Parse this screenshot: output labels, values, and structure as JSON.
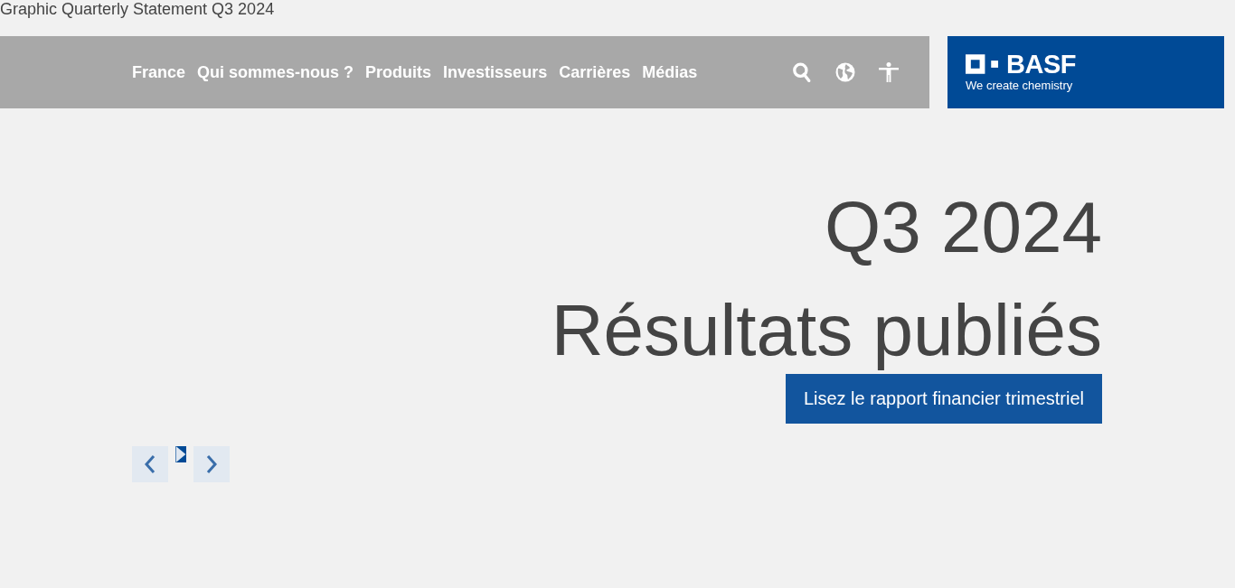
{
  "page_title": "Graphic Quarterly Statement Q3 2024",
  "nav": {
    "items": [
      "France",
      "Qui sommes-nous ?",
      "Produits",
      "Investisseurs",
      "Carrières",
      "Médias"
    ],
    "tools": [
      {
        "kind": "search"
      },
      {
        "kind": "globe"
      },
      {
        "kind": "accessibility"
      }
    ]
  },
  "logo": {
    "wordmark": "BASF",
    "tagline": "We create chemistry"
  },
  "hero": {
    "kicker": "Q3 2024",
    "headline": "Résultats publiés",
    "cta": "Lisez le rapport financier trimestriel"
  },
  "carousel_controls": [
    {
      "kind": "previous"
    },
    {
      "kind": "play"
    },
    {
      "kind": "next"
    }
  ]
}
